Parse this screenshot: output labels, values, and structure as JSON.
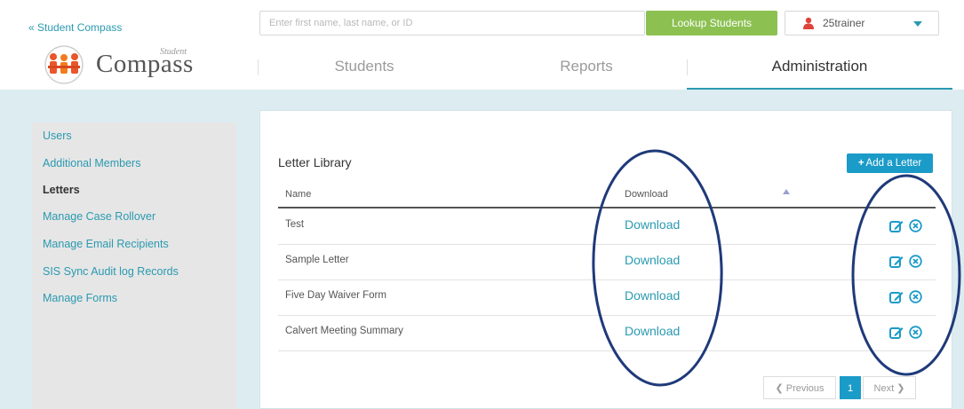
{
  "header": {
    "back_link": "« Student Compass",
    "logo_small": "Student",
    "logo_big": "Compass",
    "search_placeholder": "Enter first name, last name, or ID",
    "lookup_button": "Lookup Students",
    "user_name": "25trainer"
  },
  "nav": {
    "tabs": [
      {
        "label": "Students",
        "active": false
      },
      {
        "label": "Reports",
        "active": false
      },
      {
        "label": "Administration",
        "active": true
      }
    ]
  },
  "sidebar": {
    "items": [
      {
        "label": "Users",
        "active": false
      },
      {
        "label": "Additional Members",
        "active": false
      },
      {
        "label": "Letters",
        "active": true
      },
      {
        "label": "Manage Case Rollover",
        "active": false
      },
      {
        "label": "Manage Email Recipients",
        "active": false
      },
      {
        "label": "SIS Sync Audit log Records",
        "active": false
      },
      {
        "label": "Manage Forms",
        "active": false
      }
    ]
  },
  "panel": {
    "title": "Letter Library",
    "add_button": "Add a Letter",
    "columns": {
      "name": "Name",
      "download": "Download"
    },
    "rows": [
      {
        "name": "Test",
        "download": "Download"
      },
      {
        "name": "Sample Letter",
        "download": "Download"
      },
      {
        "name": "Five Day Waiver Form",
        "download": "Download"
      },
      {
        "name": "Calvert Meeting Summary",
        "download": "Download"
      }
    ],
    "pagination": {
      "previous": "Previous",
      "current_page": "1",
      "next": "Next"
    }
  },
  "colors": {
    "accent": "#2a9ab0",
    "button_blue": "#1b9bc8",
    "lookup_green": "#8cc152",
    "annotation_navy": "#1f3a7a"
  }
}
